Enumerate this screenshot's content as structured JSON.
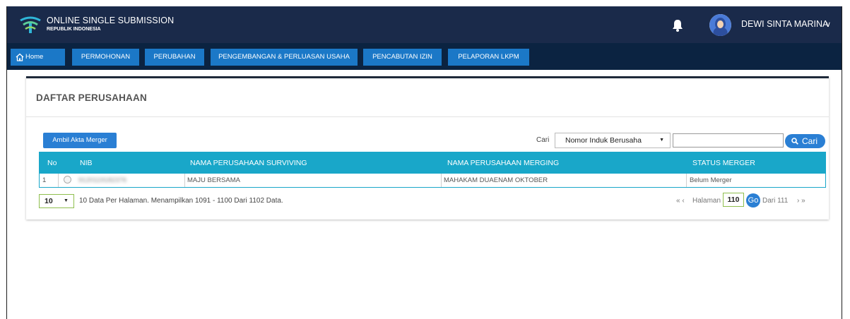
{
  "header": {
    "title": "ONLINE SINGLE SUBMISSION",
    "subtitle": "REPUBLIK INDONESIA",
    "user_name": "DEWI SINTA MARINA",
    "user_chevron": "∨",
    "logo_icon": "oss-logo-icon",
    "bell_icon": "bell-icon"
  },
  "nav": {
    "items": [
      {
        "label": "Home",
        "icon": "home-icon"
      },
      {
        "label": "PERMOHONAN"
      },
      {
        "label": "PERUBAHAN"
      },
      {
        "label": "PENGEMBANGAN & PERLUASAN USAHA"
      },
      {
        "label": "PENCABUTAN IZIN"
      },
      {
        "label": "PELAPORAN LKPM"
      }
    ]
  },
  "panel": {
    "title": "DAFTAR PERUSAHAAN",
    "merge_button": "Ambil Akta Merger",
    "search": {
      "label": "Cari",
      "selected_option": "Nomor Induk Berusaha",
      "input_value": "",
      "button_label": "Cari"
    },
    "table": {
      "headers": [
        "No",
        "NIB",
        "NAMA PERUSAHAAN SURVIVING",
        "NAMA PERUSAHAAN MERGING",
        "STATUS MERGER"
      ],
      "rows": [
        {
          "no": "1",
          "nib": "9120119182376",
          "surviving": "MAJU BERSAMA",
          "merging": "MAHAKAM DUAENAM OKTOBER",
          "status": "Belum Merger"
        }
      ]
    },
    "pagination": {
      "per_page": "10",
      "summary": "10 Data Per Halaman. Menampilkan 1091 - 1100 Dari 1102 Data.",
      "prev": "« ‹",
      "page_label": "Halaman",
      "current_page": "110",
      "go_label": "Go",
      "total_label": "Dari 111",
      "next": "› »"
    }
  },
  "colors": {
    "topbar": "#1a2a4a",
    "navbar": "#0b2341",
    "nav_button": "#1b78c7",
    "table_header": "#19a7c9",
    "primary_button": "#2a7fd4"
  }
}
